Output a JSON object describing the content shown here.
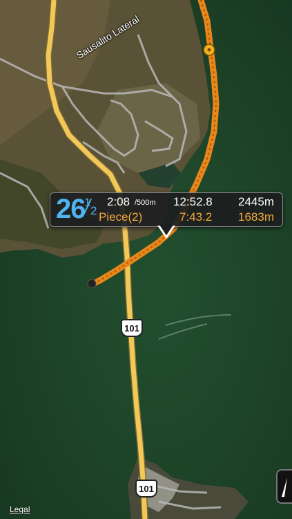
{
  "map": {
    "road_label": "Sausalito Lateral",
    "shield_1": "101",
    "shield_2": "101",
    "legal_label": "Legal"
  },
  "hud": {
    "stroke_rate_whole": "26",
    "stroke_rate_frac_num": "1",
    "stroke_rate_frac_den": "2",
    "split_time": "2:08",
    "split_unit": "/500m",
    "elapsed_time": "12:52.8",
    "total_distance": "2445m",
    "piece_label": "Piece(2)",
    "piece_time": "7:43.2",
    "piece_distance": "1683m"
  },
  "colors": {
    "stroke_rate": "#4fb3f0",
    "piece_orange": "#f4a93a",
    "track_orange": "#e8871a",
    "highway_yellow": "#f3c85a",
    "water": "#1d4a2c"
  }
}
